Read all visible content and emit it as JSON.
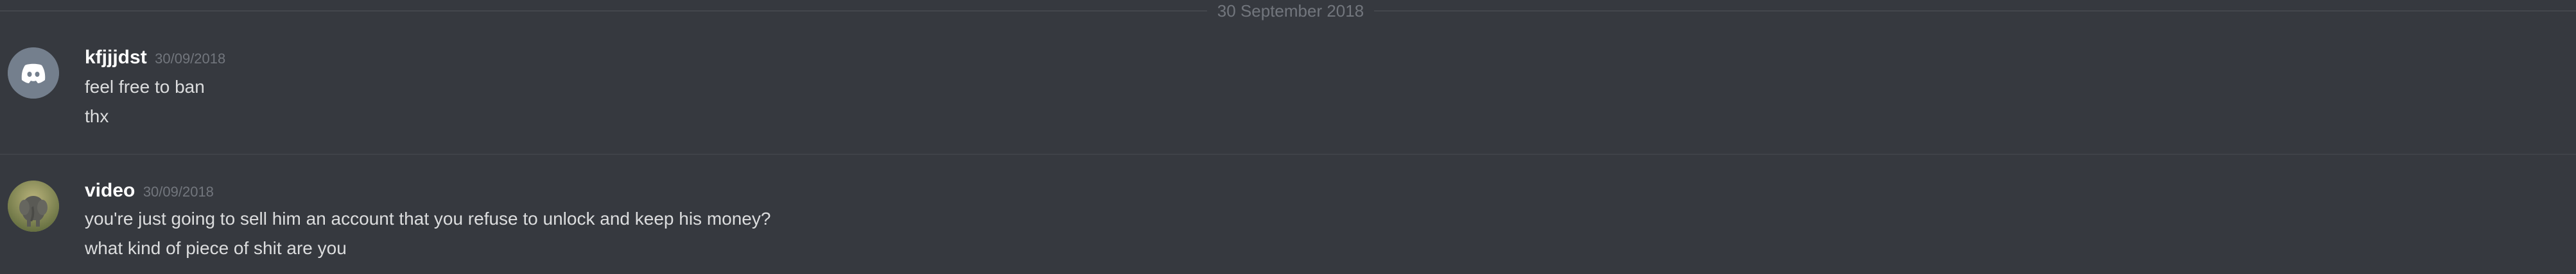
{
  "divider": {
    "date": "30 September 2018"
  },
  "messages": [
    {
      "username": "kfjjjdst",
      "timestamp": "30/09/2018",
      "avatar": "discord-default-avatar",
      "lines": [
        "feel free to ban",
        "thx"
      ]
    },
    {
      "username": "video",
      "timestamp": "30/09/2018",
      "avatar": "elephant-photo-avatar",
      "lines": [
        "you're just going to sell him an account that you refuse to unlock and keep his money?",
        "what kind of piece of shit are you"
      ]
    }
  ],
  "colors": {
    "background": "#36393f",
    "username": "#ffffff",
    "message_text": "#dcddde",
    "timestamp": "#72767d",
    "default_avatar": "#747f8d"
  }
}
